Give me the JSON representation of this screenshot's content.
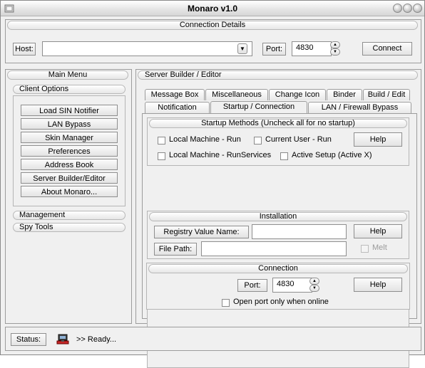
{
  "window": {
    "title": "Monaro v1.0"
  },
  "connection_details": {
    "header": "Connection Details",
    "host_label": "Host:",
    "host_value": "",
    "port_label": "Port:",
    "port_value": "4830",
    "connect_label": "Connect"
  },
  "main_menu": {
    "header": "Main Menu",
    "client_options": "Client Options",
    "items": [
      "Load SIN Notifier",
      "LAN Bypass",
      "Skin Manager",
      "Preferences",
      "Address Book",
      "Server Builder/Editor",
      "About Monaro..."
    ],
    "management": "Management",
    "spy_tools": "Spy Tools"
  },
  "server_builder": {
    "header": "Server Builder / Editor",
    "tabs_row1": [
      "Message Box",
      "Miscellaneous",
      "Change Icon",
      "Binder",
      "Build / Edit"
    ],
    "tabs_row2": [
      "Notification",
      "Startup / Connection",
      "LAN / Firewall Bypass"
    ],
    "active_tab": "Startup / Connection",
    "startup": {
      "title": "Startup Methods (Uncheck all for no startup)",
      "local_machine_run": "Local Machine - Run",
      "current_user_run": "Current User - Run",
      "local_machine_runservices": "Local Machine - RunServices",
      "active_setup": "Active Setup (Active X)",
      "help": "Help"
    },
    "installation": {
      "title": "Installation",
      "registry_label": "Registry Value Name:",
      "registry_value": "",
      "file_path_label": "File Path:",
      "file_path_value": "",
      "help": "Help",
      "melt": "Melt"
    },
    "connection": {
      "title": "Connection",
      "port_label": "Port:",
      "port_value": "4830",
      "help": "Help",
      "open_port_online": "Open port only when online"
    }
  },
  "status": {
    "label": "Status:",
    "text": ">> Ready..."
  },
  "colors": {
    "window_bg": "#f0f0f0",
    "border": "#9c9c9c"
  }
}
